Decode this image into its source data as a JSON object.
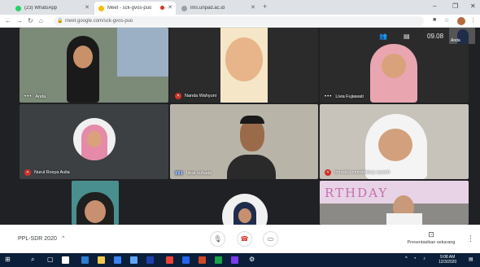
{
  "browser": {
    "tabs": [
      {
        "label": "(23) WhatsApp",
        "icon": "whatsapp-icon",
        "color": "#25d366"
      },
      {
        "label": "Meet - sck-gvos-puo",
        "icon": "meet-icon",
        "color": "#fbbc04"
      },
      {
        "label": "lms.unpad.ac.id",
        "icon": "globe-icon",
        "color": "#5f6368"
      }
    ],
    "url": "meet.google.com/sck-gvos-puo"
  },
  "meet": {
    "clock": "09.08",
    "self_label": "Anda",
    "meeting_code": "PPL-SDR 2020",
    "present_label": "Presentasikan sekarang",
    "participants": [
      {
        "name": "Anda",
        "status": "dots"
      },
      {
        "name": "Nanda Wahyuni",
        "status": "muted"
      },
      {
        "name": "Livia Fujiawati",
        "status": "dots"
      },
      {
        "name": "Nurul Rosya Aulia",
        "status": "muted"
      },
      {
        "name": "Iskat suhada",
        "status": "speaking"
      },
      {
        "name": "Imroatul murodatusy syarah",
        "status": "muted"
      }
    ],
    "banner_text": "RTHDAY"
  },
  "taskbar": {
    "time": "9:08 AM",
    "date": "12/3/2020"
  }
}
